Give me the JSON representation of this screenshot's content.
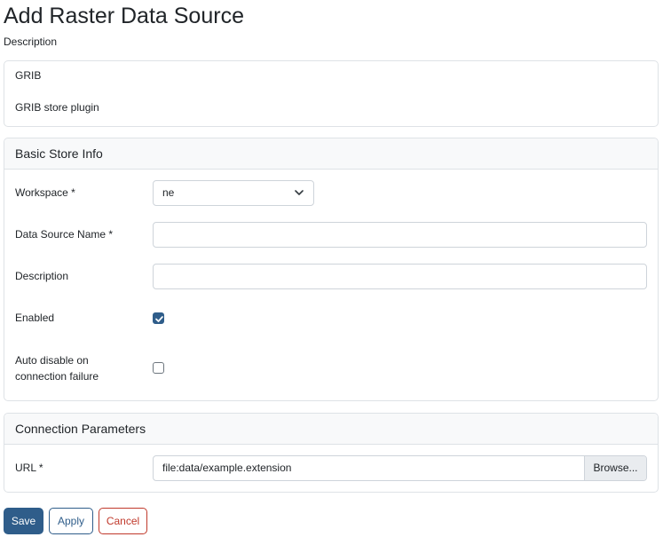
{
  "page": {
    "title": "Add Raster Data Source",
    "subtitle": "Description"
  },
  "info": {
    "type": "GRIB",
    "plugin": "GRIB store plugin"
  },
  "basic": {
    "header": "Basic Store Info",
    "workspace_label": "Workspace *",
    "workspace_value": "ne",
    "name_label": "Data Source Name *",
    "name_value": "",
    "description_label": "Description",
    "description_value": "",
    "enabled_label": "Enabled",
    "enabled": true,
    "auto_disable_label_line1": "Auto disable on",
    "auto_disable_label_line2": "connection failure",
    "auto_disable": false
  },
  "connection": {
    "header": "Connection Parameters",
    "url_label": "URL *",
    "url_value": "file:data/example.extension",
    "browse_label": "Browse..."
  },
  "buttons": {
    "save": "Save",
    "apply": "Apply",
    "cancel": "Cancel"
  },
  "colors": {
    "primary": "#2f5d8a",
    "danger": "#c0392b",
    "border": "#dee2e6",
    "header_bg": "#f8f9fa"
  },
  "icons": {
    "workspace_dropdown": "chevron-down-icon",
    "checkbox_checked": "checkmark-icon"
  }
}
